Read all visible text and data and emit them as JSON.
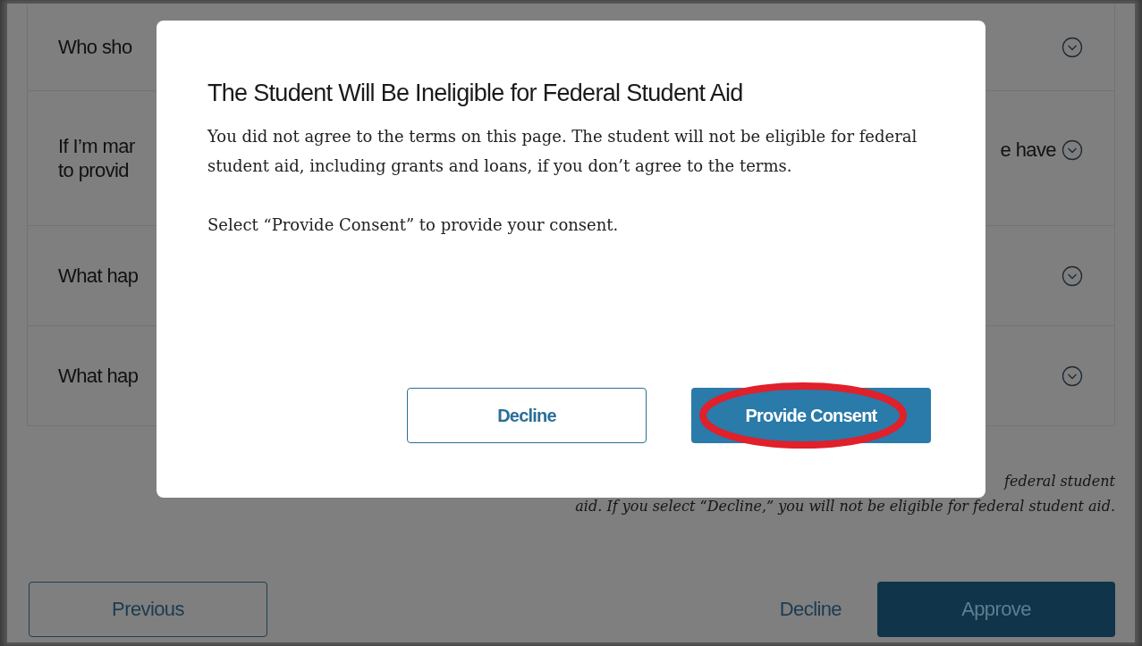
{
  "faq": {
    "items": [
      {
        "lines": [
          "Who sho"
        ],
        "expanded": false
      },
      {
        "lines": [
          "If I’m mar",
          "to provid"
        ],
        "trailing": "e have",
        "expanded": false
      },
      {
        "lines": [
          "What hap"
        ],
        "expanded": false
      },
      {
        "lines": [
          "What hap"
        ],
        "expanded": false
      }
    ]
  },
  "note": {
    "lines": [
      "federal student",
      "aid. If you select “Decline,” you will not be eligible for federal student aid."
    ]
  },
  "footer": {
    "previous": "Previous",
    "decline": "Decline",
    "approve": "Approve"
  },
  "dialog": {
    "title": "The Student Will Be Ineligible for Federal Student Aid",
    "paragraphs": [
      "You did not agree to the terms on this page. The student will not be eligible for federal student aid, including grants and loans, if you don’t agree to the terms.",
      "Select “Provide Consent” to provide your consent."
    ],
    "buttons": [
      {
        "label": "Decline",
        "kind": "secondary"
      },
      {
        "label": "Provide Consent",
        "kind": "primary",
        "highlighted": true
      }
    ]
  }
}
